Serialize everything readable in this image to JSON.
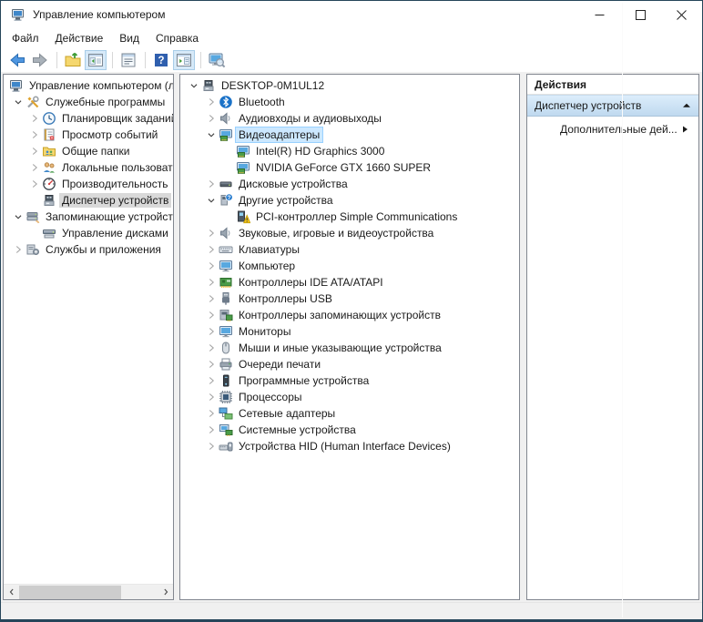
{
  "window": {
    "title": "Управление компьютером",
    "app_icon": "computer-management-icon",
    "controls": [
      {
        "name": "minimize-button",
        "icon": "minimize-icon"
      },
      {
        "name": "maximize-button",
        "icon": "maximize-icon"
      },
      {
        "name": "close-button",
        "icon": "close-icon"
      }
    ]
  },
  "menu": {
    "items": [
      {
        "label": "Файл",
        "name": "menu-file"
      },
      {
        "label": "Действие",
        "name": "menu-action"
      },
      {
        "label": "Вид",
        "name": "menu-view"
      },
      {
        "label": "Справка",
        "name": "menu-help"
      }
    ]
  },
  "toolbar": {
    "buttons": [
      {
        "type": "button",
        "icon": "back-icon",
        "toggled": false
      },
      {
        "type": "button",
        "icon": "forward-icon",
        "toggled": false
      },
      {
        "type": "sep"
      },
      {
        "type": "button",
        "icon": "up-folder-icon",
        "toggled": false
      },
      {
        "type": "button",
        "icon": "show-console-tree-icon",
        "toggled": true
      },
      {
        "type": "sep"
      },
      {
        "type": "button",
        "icon": "properties-icon",
        "toggled": false
      },
      {
        "type": "sep"
      },
      {
        "type": "button",
        "icon": "help-icon",
        "toggled": false
      },
      {
        "type": "button",
        "icon": "show-action-pane-icon",
        "toggled": true
      },
      {
        "type": "sep"
      },
      {
        "type": "button",
        "icon": "scan-hardware-icon",
        "toggled": false
      }
    ]
  },
  "sidebar": {
    "items": [
      {
        "label": "Управление компьютером (л",
        "level": 0,
        "chevron": "none",
        "icon": "computer-management-icon",
        "selected": false
      },
      {
        "label": "Служебные программы",
        "level": 1,
        "chevron": "expanded",
        "icon": "system-tools-icon",
        "selected": false
      },
      {
        "label": "Планировщик заданий",
        "level": 2,
        "chevron": "collapsed",
        "icon": "task-scheduler-icon",
        "selected": false
      },
      {
        "label": "Просмотр событий",
        "level": 2,
        "chevron": "collapsed",
        "icon": "event-viewer-icon",
        "selected": false
      },
      {
        "label": "Общие папки",
        "level": 2,
        "chevron": "collapsed",
        "icon": "shared-folders-icon",
        "selected": false
      },
      {
        "label": "Локальные пользовате",
        "level": 2,
        "chevron": "collapsed",
        "icon": "local-users-icon",
        "selected": false
      },
      {
        "label": "Производительность",
        "level": 2,
        "chevron": "collapsed",
        "icon": "performance-icon",
        "selected": false
      },
      {
        "label": "Диспетчер устройств",
        "level": 2,
        "chevron": "none",
        "icon": "device-manager-icon",
        "selected": true
      },
      {
        "label": "Запоминающие устройст",
        "level": 1,
        "chevron": "expanded",
        "icon": "storage-devices-icon",
        "selected": false
      },
      {
        "label": "Управление дисками",
        "level": 2,
        "chevron": "none",
        "icon": "disk-management-icon",
        "selected": false
      },
      {
        "label": "Службы и приложения",
        "level": 1,
        "chevron": "collapsed",
        "icon": "services-icon",
        "selected": false
      }
    ]
  },
  "device_tree": {
    "items": [
      {
        "label": "DESKTOP-0M1UL12",
        "level": 0,
        "chevron": "expanded",
        "icon": "computer-icon",
        "selected": false
      },
      {
        "label": "Bluetooth",
        "level": 1,
        "chevron": "collapsed",
        "icon": "bluetooth-icon",
        "selected": false
      },
      {
        "label": "Аудиовходы и аудиовыходы",
        "level": 1,
        "chevron": "collapsed",
        "icon": "audio-icon",
        "selected": false
      },
      {
        "label": "Видеоадаптеры",
        "level": 1,
        "chevron": "expanded",
        "icon": "display-adapter-icon",
        "selected": true
      },
      {
        "label": "Intel(R) HD Graphics 3000",
        "level": 2,
        "chevron": "none",
        "icon": "display-adapter-icon",
        "selected": false
      },
      {
        "label": "NVIDIA GeForce GTX 1660 SUPER",
        "level": 2,
        "chevron": "none",
        "icon": "display-adapter-icon",
        "selected": false
      },
      {
        "label": "Дисковые устройства",
        "level": 1,
        "chevron": "collapsed",
        "icon": "disk-drive-icon",
        "selected": false
      },
      {
        "label": "Другие устройства",
        "level": 1,
        "chevron": "expanded",
        "icon": "unknown-device-icon",
        "selected": false
      },
      {
        "label": "PCI-контроллер Simple Communications",
        "level": 2,
        "chevron": "none",
        "icon": "warning-device-icon",
        "selected": false
      },
      {
        "label": "Звуковые, игровые и видеоустройства",
        "level": 1,
        "chevron": "collapsed",
        "icon": "sound-icon",
        "selected": false
      },
      {
        "label": "Клавиатуры",
        "level": 1,
        "chevron": "collapsed",
        "icon": "keyboard-icon",
        "selected": false
      },
      {
        "label": "Компьютер",
        "level": 1,
        "chevron": "collapsed",
        "icon": "computer-category-icon",
        "selected": false
      },
      {
        "label": "Контроллеры IDE ATA/ATAPI",
        "level": 1,
        "chevron": "collapsed",
        "icon": "ide-controller-icon",
        "selected": false
      },
      {
        "label": "Контроллеры USB",
        "level": 1,
        "chevron": "collapsed",
        "icon": "usb-icon",
        "selected": false
      },
      {
        "label": "Контроллеры запоминающих устройств",
        "level": 1,
        "chevron": "collapsed",
        "icon": "storage-controller-icon",
        "selected": false
      },
      {
        "label": "Мониторы",
        "level": 1,
        "chevron": "collapsed",
        "icon": "monitor-icon",
        "selected": false
      },
      {
        "label": "Мыши и иные указывающие устройства",
        "level": 1,
        "chevron": "collapsed",
        "icon": "mouse-icon",
        "selected": false
      },
      {
        "label": "Очереди печати",
        "level": 1,
        "chevron": "collapsed",
        "icon": "printer-icon",
        "selected": false
      },
      {
        "label": "Программные устройства",
        "level": 1,
        "chevron": "collapsed",
        "icon": "software-device-icon",
        "selected": false
      },
      {
        "label": "Процессоры",
        "level": 1,
        "chevron": "collapsed",
        "icon": "processor-icon",
        "selected": false
      },
      {
        "label": "Сетевые адаптеры",
        "level": 1,
        "chevron": "collapsed",
        "icon": "network-adapter-icon",
        "selected": false
      },
      {
        "label": "Системные устройства",
        "level": 1,
        "chevron": "collapsed",
        "icon": "system-device-icon",
        "selected": false
      },
      {
        "label": "Устройства HID (Human Interface Devices)",
        "level": 1,
        "chevron": "collapsed",
        "icon": "hid-icon",
        "selected": false
      }
    ]
  },
  "actions": {
    "header": "Действия",
    "group_label": "Диспетчер устройств",
    "group_collapse_icon": "collapse-up-icon",
    "items": [
      {
        "label": "Дополнительные дей...",
        "icon": "submenu-right-icon"
      }
    ]
  },
  "statusbar": {
    "text": ""
  },
  "colors": {
    "window_border": "#26455a",
    "panel_border": "#828790",
    "selection_active": "#cce8ff",
    "selection_active_border": "#99d1ff",
    "selection_inactive": "#d9d9d9",
    "actions_group_top": "#dcedfb",
    "actions_group_bottom": "#bfd9ef",
    "toolbar_toggle_bg": "#d6e9f8",
    "toolbar_toggle_border": "#a8cde8",
    "statusbar_bg": "#f0f0f0"
  }
}
